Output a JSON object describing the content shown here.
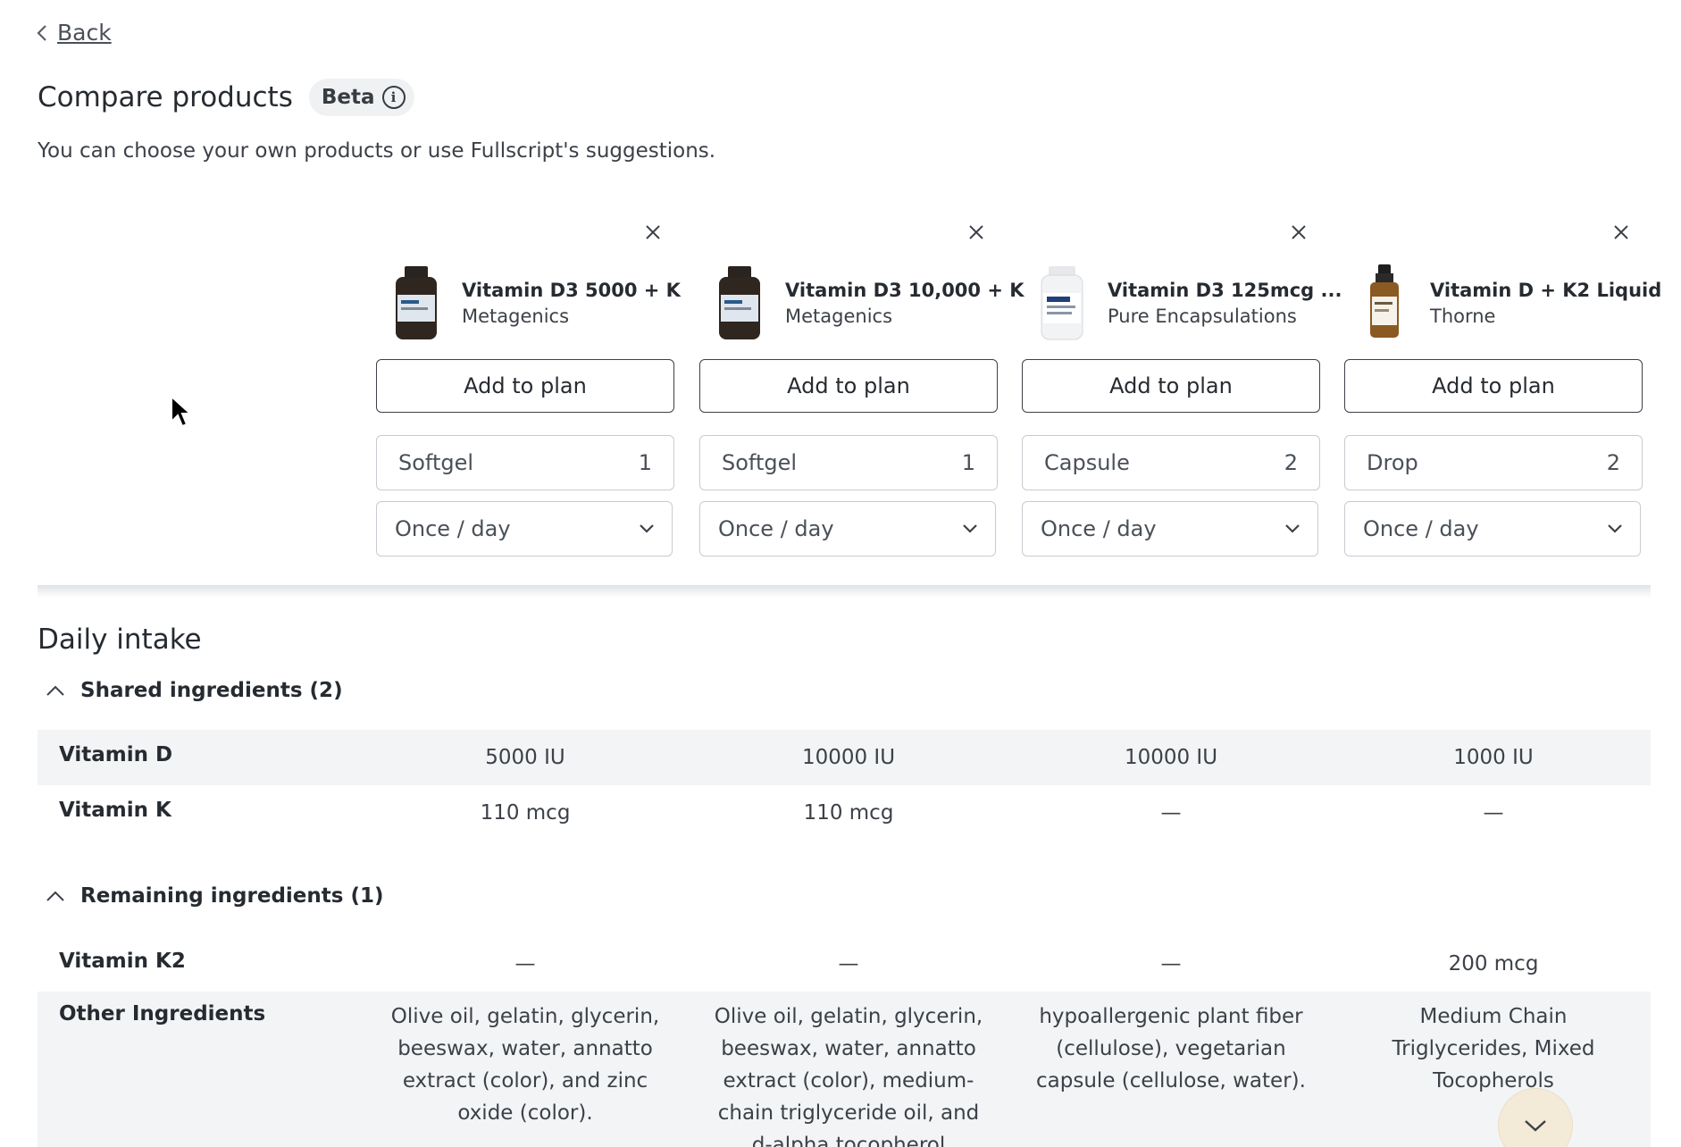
{
  "nav": {
    "back_label": "Back"
  },
  "header": {
    "title": "Compare products",
    "badge": "Beta",
    "subtitle": "You can choose your own products or use Fullscript's suggestions."
  },
  "products": [
    {
      "name": "Vitamin D3 5000 + K",
      "brand": "Metagenics",
      "add_label": "Add to plan",
      "dose_unit": "Softgel",
      "dose_qty": "1",
      "frequency": "Once / day",
      "bottle_color": "#2f2620"
    },
    {
      "name": "Vitamin D3 10,000 + K",
      "brand": "Metagenics",
      "add_label": "Add to plan",
      "dose_unit": "Softgel",
      "dose_qty": "1",
      "frequency": "Once / day",
      "bottle_color": "#2f2620"
    },
    {
      "name": "Vitamin D3 125mcg ...",
      "brand": "Pure Encapsulations",
      "add_label": "Add to plan",
      "dose_unit": "Capsule",
      "dose_qty": "2",
      "frequency": "Once / day",
      "bottle_color": "#f2f3f5"
    },
    {
      "name": "Vitamin D + K2 Liquid",
      "brand": "Thorne",
      "add_label": "Add to plan",
      "dose_unit": "Drop",
      "dose_qty": "2",
      "frequency": "Once / day",
      "bottle_color": "#8a5a22"
    }
  ],
  "daily_intake": {
    "title": "Daily intake",
    "shared": {
      "label": "Shared ingredients (2)",
      "rows": [
        {
          "name": "Vitamin D",
          "values": [
            "5000 IU",
            "10000 IU",
            "10000 IU",
            "1000 IU"
          ]
        },
        {
          "name": "Vitamin K",
          "values": [
            "110 mcg",
            "110 mcg",
            "—",
            "—"
          ]
        }
      ]
    },
    "remaining": {
      "label": "Remaining ingredients (1)",
      "rows": [
        {
          "name": "Vitamin K2",
          "values": [
            "—",
            "—",
            "—",
            "200 mcg"
          ]
        }
      ]
    },
    "other": {
      "name": "Other Ingredients",
      "values": [
        "Olive oil, gelatin, glycerin, beeswax, water, annatto extract (color), and zinc oxide (color).",
        "Olive oil, gelatin, glycerin, beeswax, water, annatto extract (color), medium-chain triglyceride oil, and d-alpha tocopherol",
        "hypoallergenic plant fiber (cellulose), vegetarian capsule (cellulose, water).",
        "Medium Chain Triglycerides, Mixed Tocopherols"
      ]
    }
  }
}
